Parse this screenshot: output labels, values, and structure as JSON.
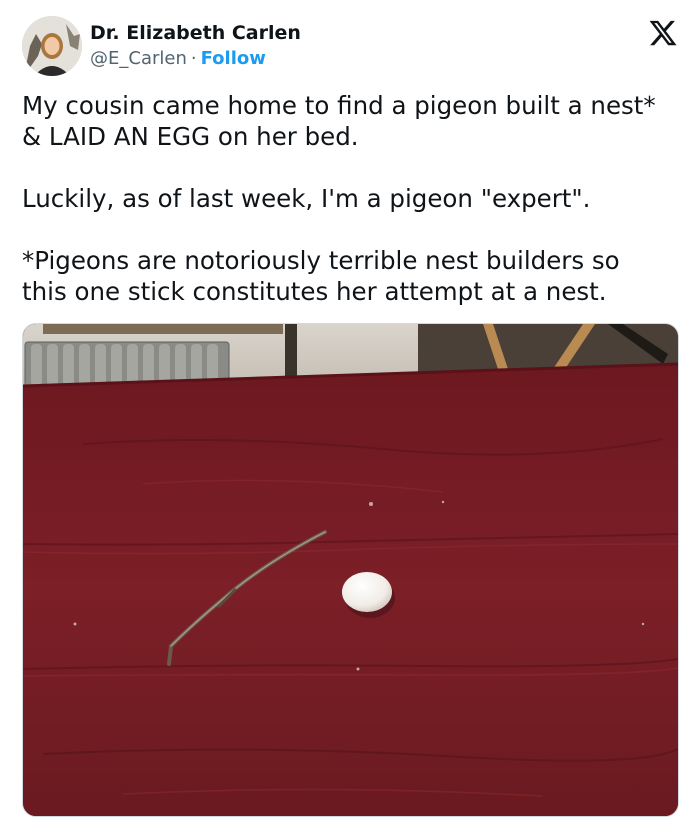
{
  "author": {
    "display_name": "Dr. Elizabeth Carlen",
    "handle": "@E_Carlen",
    "separator": "·",
    "follow_label": "Follow"
  },
  "tweet": {
    "paragraphs": [
      "My cousin came home to find a pigeon built a nest* & LAID AN EGG on her bed.",
      "Luckily, as of last week, I'm a pigeon \"expert\".",
      "*Pigeons are notoriously terrible nest builders so this one stick constitutes her attempt at a nest."
    ]
  },
  "icons": {
    "platform": "x-logo-icon",
    "avatar": "profile-photo"
  },
  "colors": {
    "link": "#1d9bf0",
    "text": "#0f1419",
    "muted": "#536471",
    "bedspread": "#7a1d24"
  }
}
